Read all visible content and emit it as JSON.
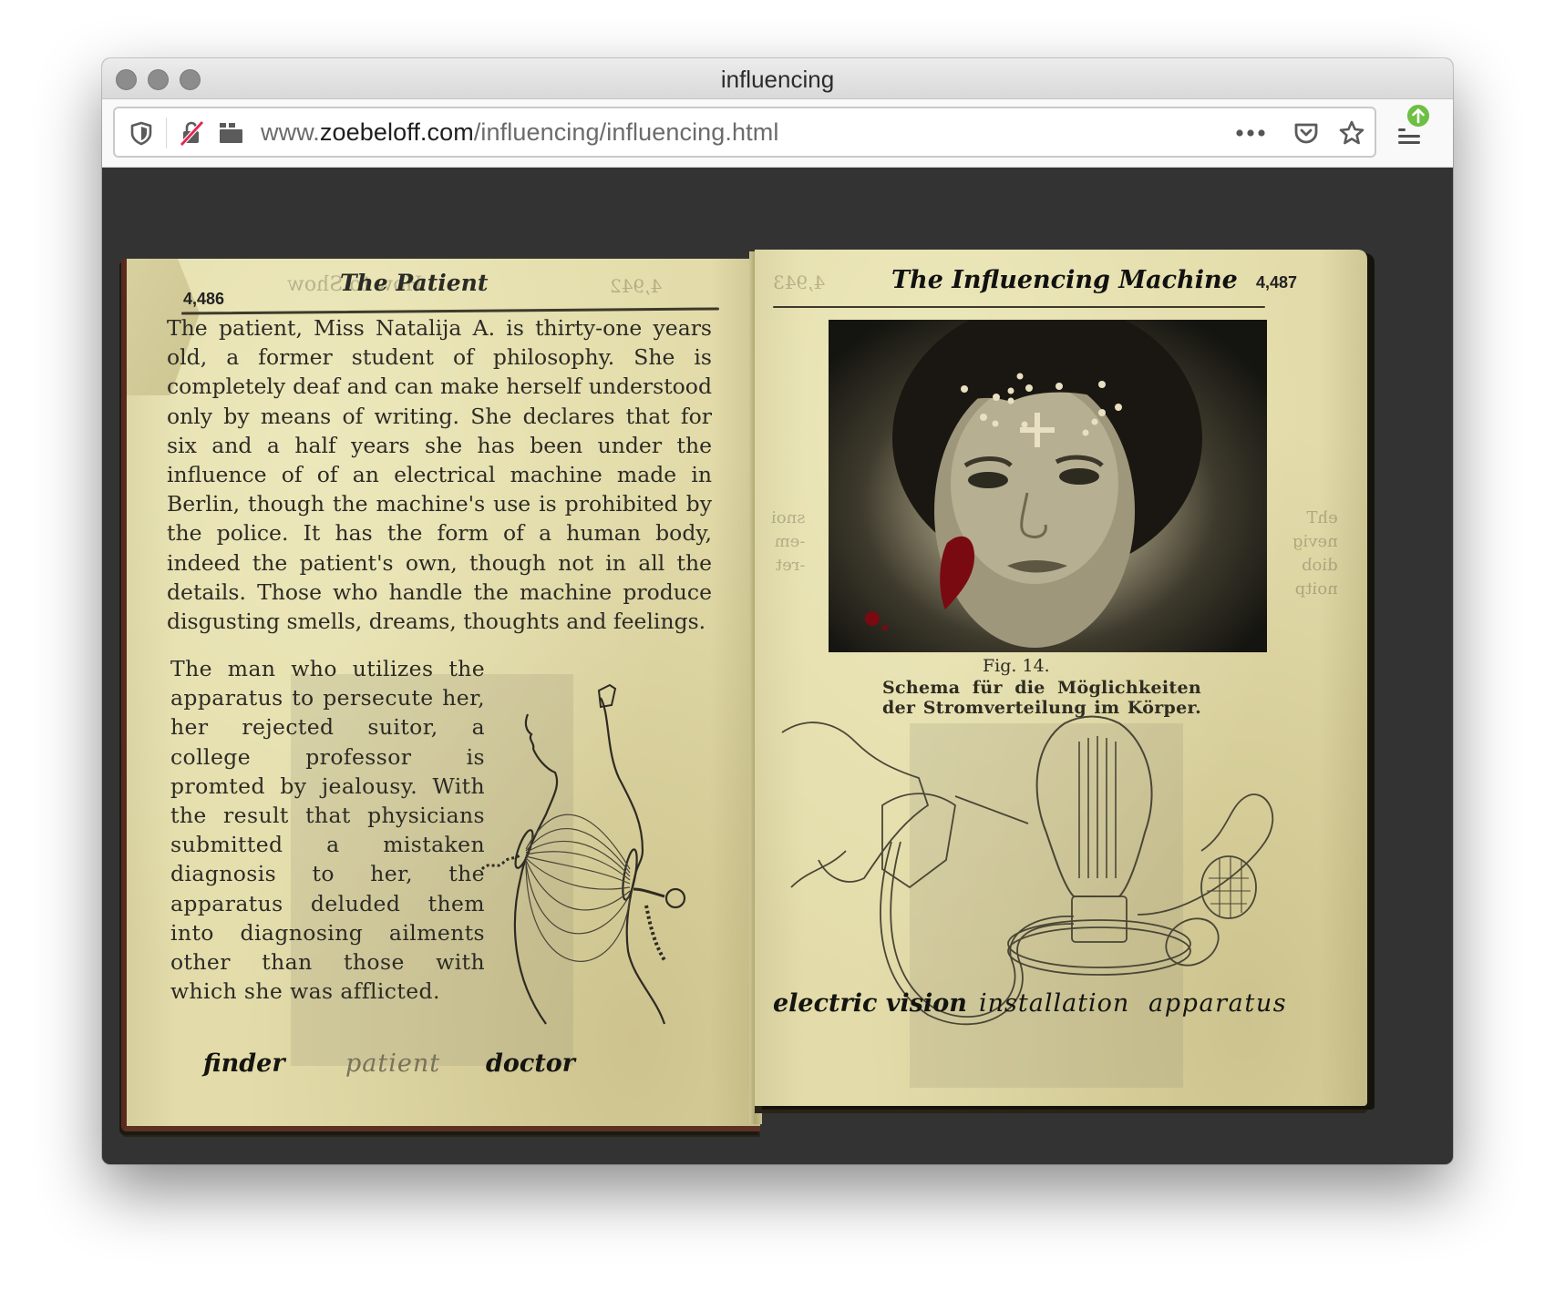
{
  "window": {
    "title": "influencing",
    "traffic_lights": [
      "close",
      "minimize",
      "maximize"
    ]
  },
  "toolbar": {
    "url_host_prefix": "www.",
    "url_host": "zoebeloff.com",
    "url_path": "/influencing/influencing.html",
    "icons": {
      "tracking_protection": "shield-icon",
      "insecure_connection": "lock-slash-icon",
      "media_permissions": "media-icon",
      "page_actions": "more-horizontal-icon",
      "pocket": "pocket-icon",
      "bookmark": "star-icon",
      "app_menu": "hamburger-menu-icon",
      "update_badge": "update-arrow-icon"
    },
    "update_badge_color": "#6fbf44"
  },
  "book": {
    "left_page": {
      "page_number": "4,486",
      "ghost_header": "How to Show",
      "ghost_page_number": "4,942",
      "title": "The Patient",
      "paragraph_1": "The patient, Miss Natalija A. is thirty-one years old, a former student of philosophy. She is completely deaf and can make herself understood only by means of writing. She declares that for six and a half years she has been under the influence of of an electrical machine made in Berlin, though the machine's use is prohibited by the police. It has the form of a human body, indeed the patient's own, though not in all the details. Those who handle the machine produce disgusting smells, dreams, thoughts and feelings.",
      "paragraph_2": "The man who utilizes the apparatus to persecute her, her rejected suitor, a college professor is promted by jealousy. With the result that physicians submitted a mistaken diagnosis to her, the apparatus deluded them into diagnosing ailments other than those with which she was afflicted.",
      "illustration": "body-with-wires-illustration",
      "nav": [
        {
          "label": "finder",
          "current": false
        },
        {
          "label": "patient",
          "current": true
        },
        {
          "label": "doctor",
          "current": false
        }
      ]
    },
    "right_page": {
      "page_number": "4,487",
      "ghost_page_number": "4,943",
      "title": "The Influencing Machine",
      "photo": "portrait-photo",
      "fig_label": "Fig. 14.",
      "fig_caption_line1": "Schema für die Möglichkeiten",
      "fig_caption_line2": "der Stromverteilung im Körper.",
      "illustration": "lamp-apparatus-illustration",
      "nav": [
        {
          "label": "electric vision",
          "current": false
        },
        {
          "label": "installation",
          "current": false
        },
        {
          "label": "apparatus",
          "current": false
        }
      ]
    }
  },
  "colors": {
    "page_background": "#333333",
    "paper": "#e3dcaa",
    "current_nav": "#77725a",
    "blood": "#7a0a12"
  }
}
